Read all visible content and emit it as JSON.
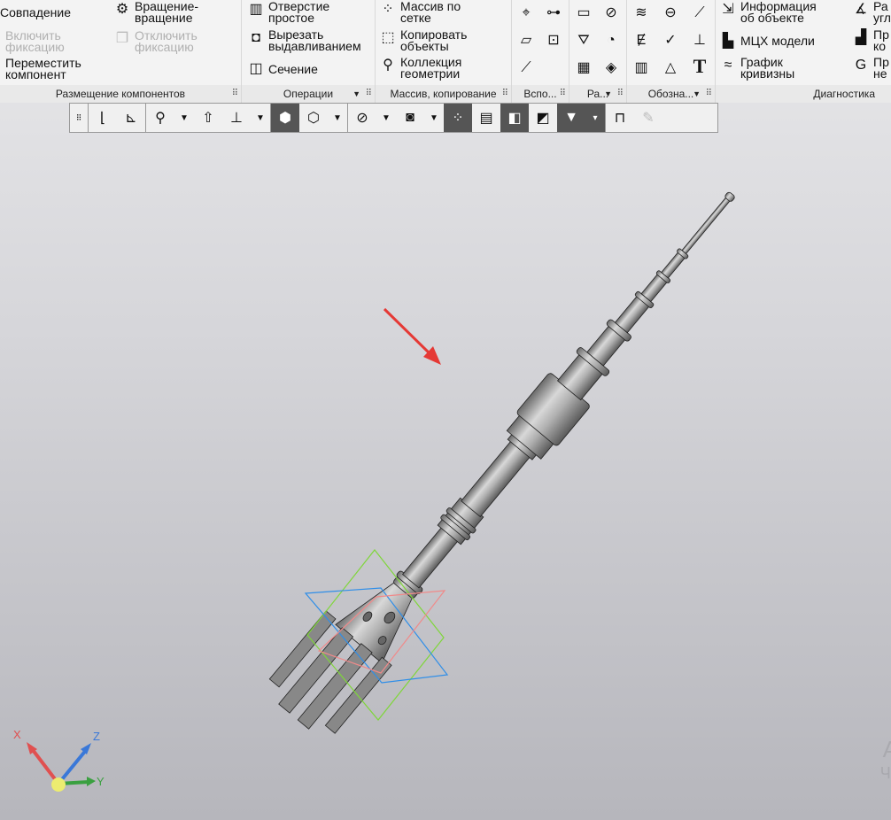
{
  "ribbon": {
    "groups": [
      {
        "label": "Размещение компонентов",
        "items": [
          "Совпадение",
          "Вращение-вращение",
          "Включить фиксацию",
          "Отключить фиксацию",
          "Переместить компонент"
        ]
      },
      {
        "label": "Операции",
        "items": [
          "Отверстие простое",
          "Вырезать выдавливанием",
          "Сечение"
        ]
      },
      {
        "label": "Массив, копирование",
        "items": [
          "Массив по сетке",
          "Копировать объекты",
          "Коллекция геометрии"
        ]
      },
      {
        "label": "Вспо..."
      },
      {
        "label": "Ра..."
      },
      {
        "label": "Обозна..."
      },
      {
        "label": "Диагностика",
        "items": [
          "Информация об объекте",
          "МЦХ модели",
          "График кривизны",
          "Ра угл",
          "Пр ко",
          "Пр не"
        ]
      }
    ]
  },
  "watermark": [
    "А",
    "Чт"
  ],
  "triad": {
    "x": "X",
    "y": "Y",
    "z": "Z",
    "colors": {
      "x": "#e05050",
      "y": "#3aa040",
      "z": "#3a78d8"
    }
  },
  "annotation_color": "#e53935"
}
